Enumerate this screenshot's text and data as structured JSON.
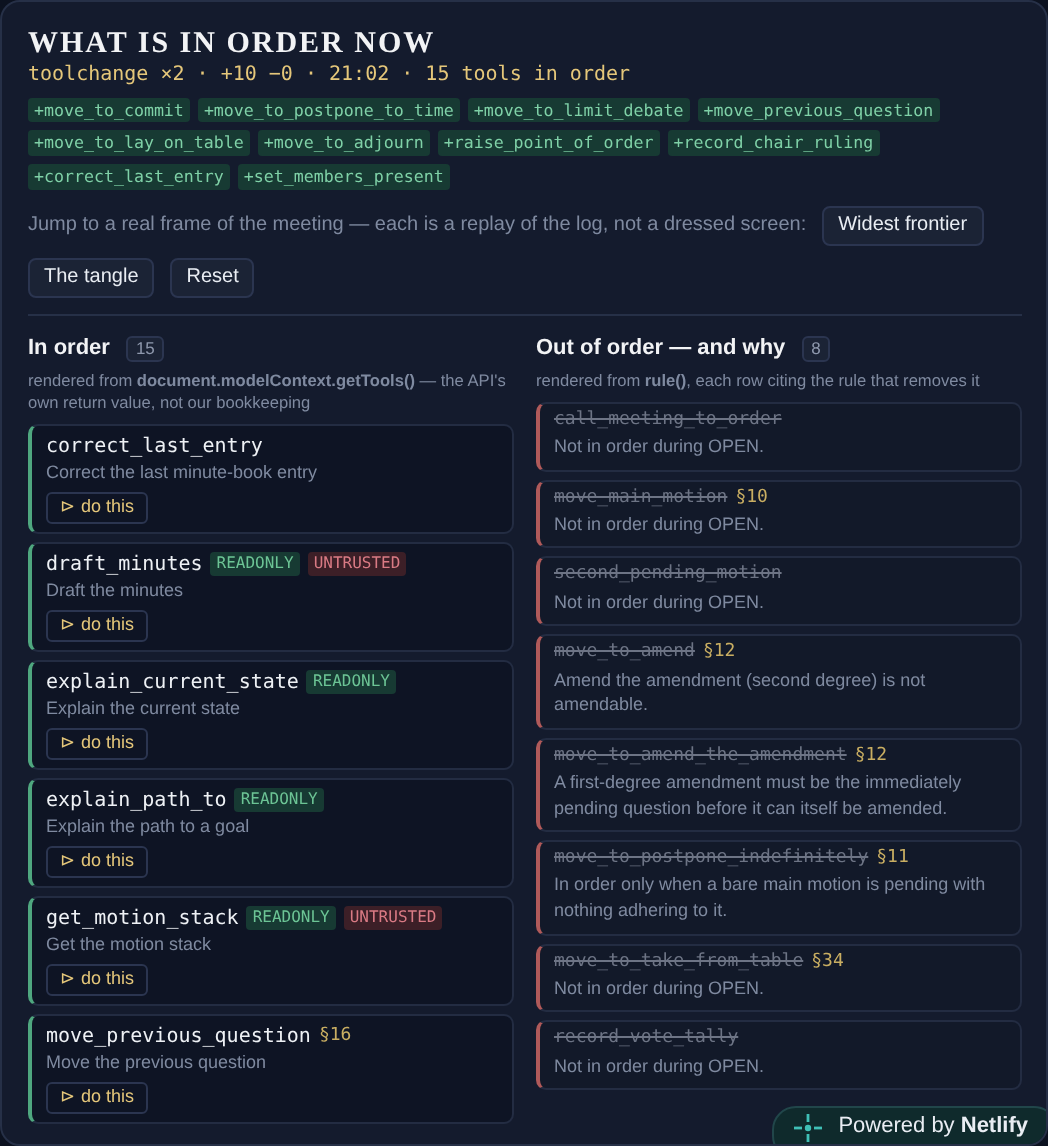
{
  "header": {
    "title": "WHAT IS IN ORDER NOW",
    "status": "toolchange ×2 · +10 −0 · 21:02 · 15 tools in order",
    "added_tools": [
      "+move_to_commit",
      "+move_to_postpone_to_time",
      "+move_to_limit_debate",
      "+move_previous_question",
      "+move_to_lay_on_table",
      "+move_to_adjourn",
      "+raise_point_of_order",
      "+record_chair_ruling",
      "+correct_last_entry",
      "+set_members_present"
    ],
    "jump_text": "Jump to a real frame of the meeting — each is a replay of the log, not a dressed screen:",
    "frame_buttons": [
      "Widest frontier",
      "The tangle",
      "Reset"
    ]
  },
  "in_order": {
    "title": "In order",
    "count": "15",
    "note": "rendered from **document.modelContext.getTools()** — the API's own return value, not our bookkeeping",
    "tools": [
      {
        "name": "correct_last_entry",
        "description": "Correct the last minute-book entry",
        "action": "⊳ do this"
      },
      {
        "name": "draft_minutes",
        "tags": [
          {
            "label": "READONLY",
            "kind": "readonly"
          },
          {
            "label": "UNTRUSTED",
            "kind": "untrusted"
          }
        ],
        "description": "Draft the minutes",
        "action": "⊳ do this"
      },
      {
        "name": "explain_current_state",
        "tags": [
          {
            "label": "READONLY",
            "kind": "readonly"
          }
        ],
        "description": "Explain the current state",
        "action": "⊳ do this"
      },
      {
        "name": "explain_path_to",
        "tags": [
          {
            "label": "READONLY",
            "kind": "readonly"
          }
        ],
        "description": "Explain the path to a goal",
        "action": "⊳ do this"
      },
      {
        "name": "get_motion_stack",
        "tags": [
          {
            "label": "READONLY",
            "kind": "readonly"
          },
          {
            "label": "UNTRUSTED",
            "kind": "untrusted"
          }
        ],
        "description": "Get the motion stack",
        "action": "⊳ do this"
      },
      {
        "name": "move_previous_question",
        "section": "§16",
        "description": "Move the previous question",
        "action": "⊳ do this"
      }
    ]
  },
  "out_of_order": {
    "title": "Out of order — and why",
    "count": "8",
    "note": "rendered from **rule()**, each row citing the rule that removes it",
    "tools": [
      {
        "name": "call_meeting_to_order",
        "reason": "Not in order during OPEN."
      },
      {
        "name": "move_main_motion",
        "section": "§10",
        "reason": "Not in order during OPEN."
      },
      {
        "name": "second_pending_motion",
        "reason": "Not in order during OPEN."
      },
      {
        "name": "move_to_amend",
        "section": "§12",
        "reason": "Amend the amendment (second degree) is not amendable."
      },
      {
        "name": "move_to_amend_the_amendment",
        "section": "§12",
        "reason": "A first-degree amendment must be the immediately pending question before it can itself be amended."
      },
      {
        "name": "move_to_postpone_indefinitely",
        "section": "§11",
        "reason": "In order only when a bare main motion is pending with nothing adhering to it."
      },
      {
        "name": "move_to_take_from_table",
        "section": "§34",
        "reason": "Not in order during OPEN."
      },
      {
        "name": "record_vote_tally",
        "reason": "Not in order during OPEN."
      }
    ]
  },
  "badge": {
    "text": "Powered by **Netlify**"
  }
}
